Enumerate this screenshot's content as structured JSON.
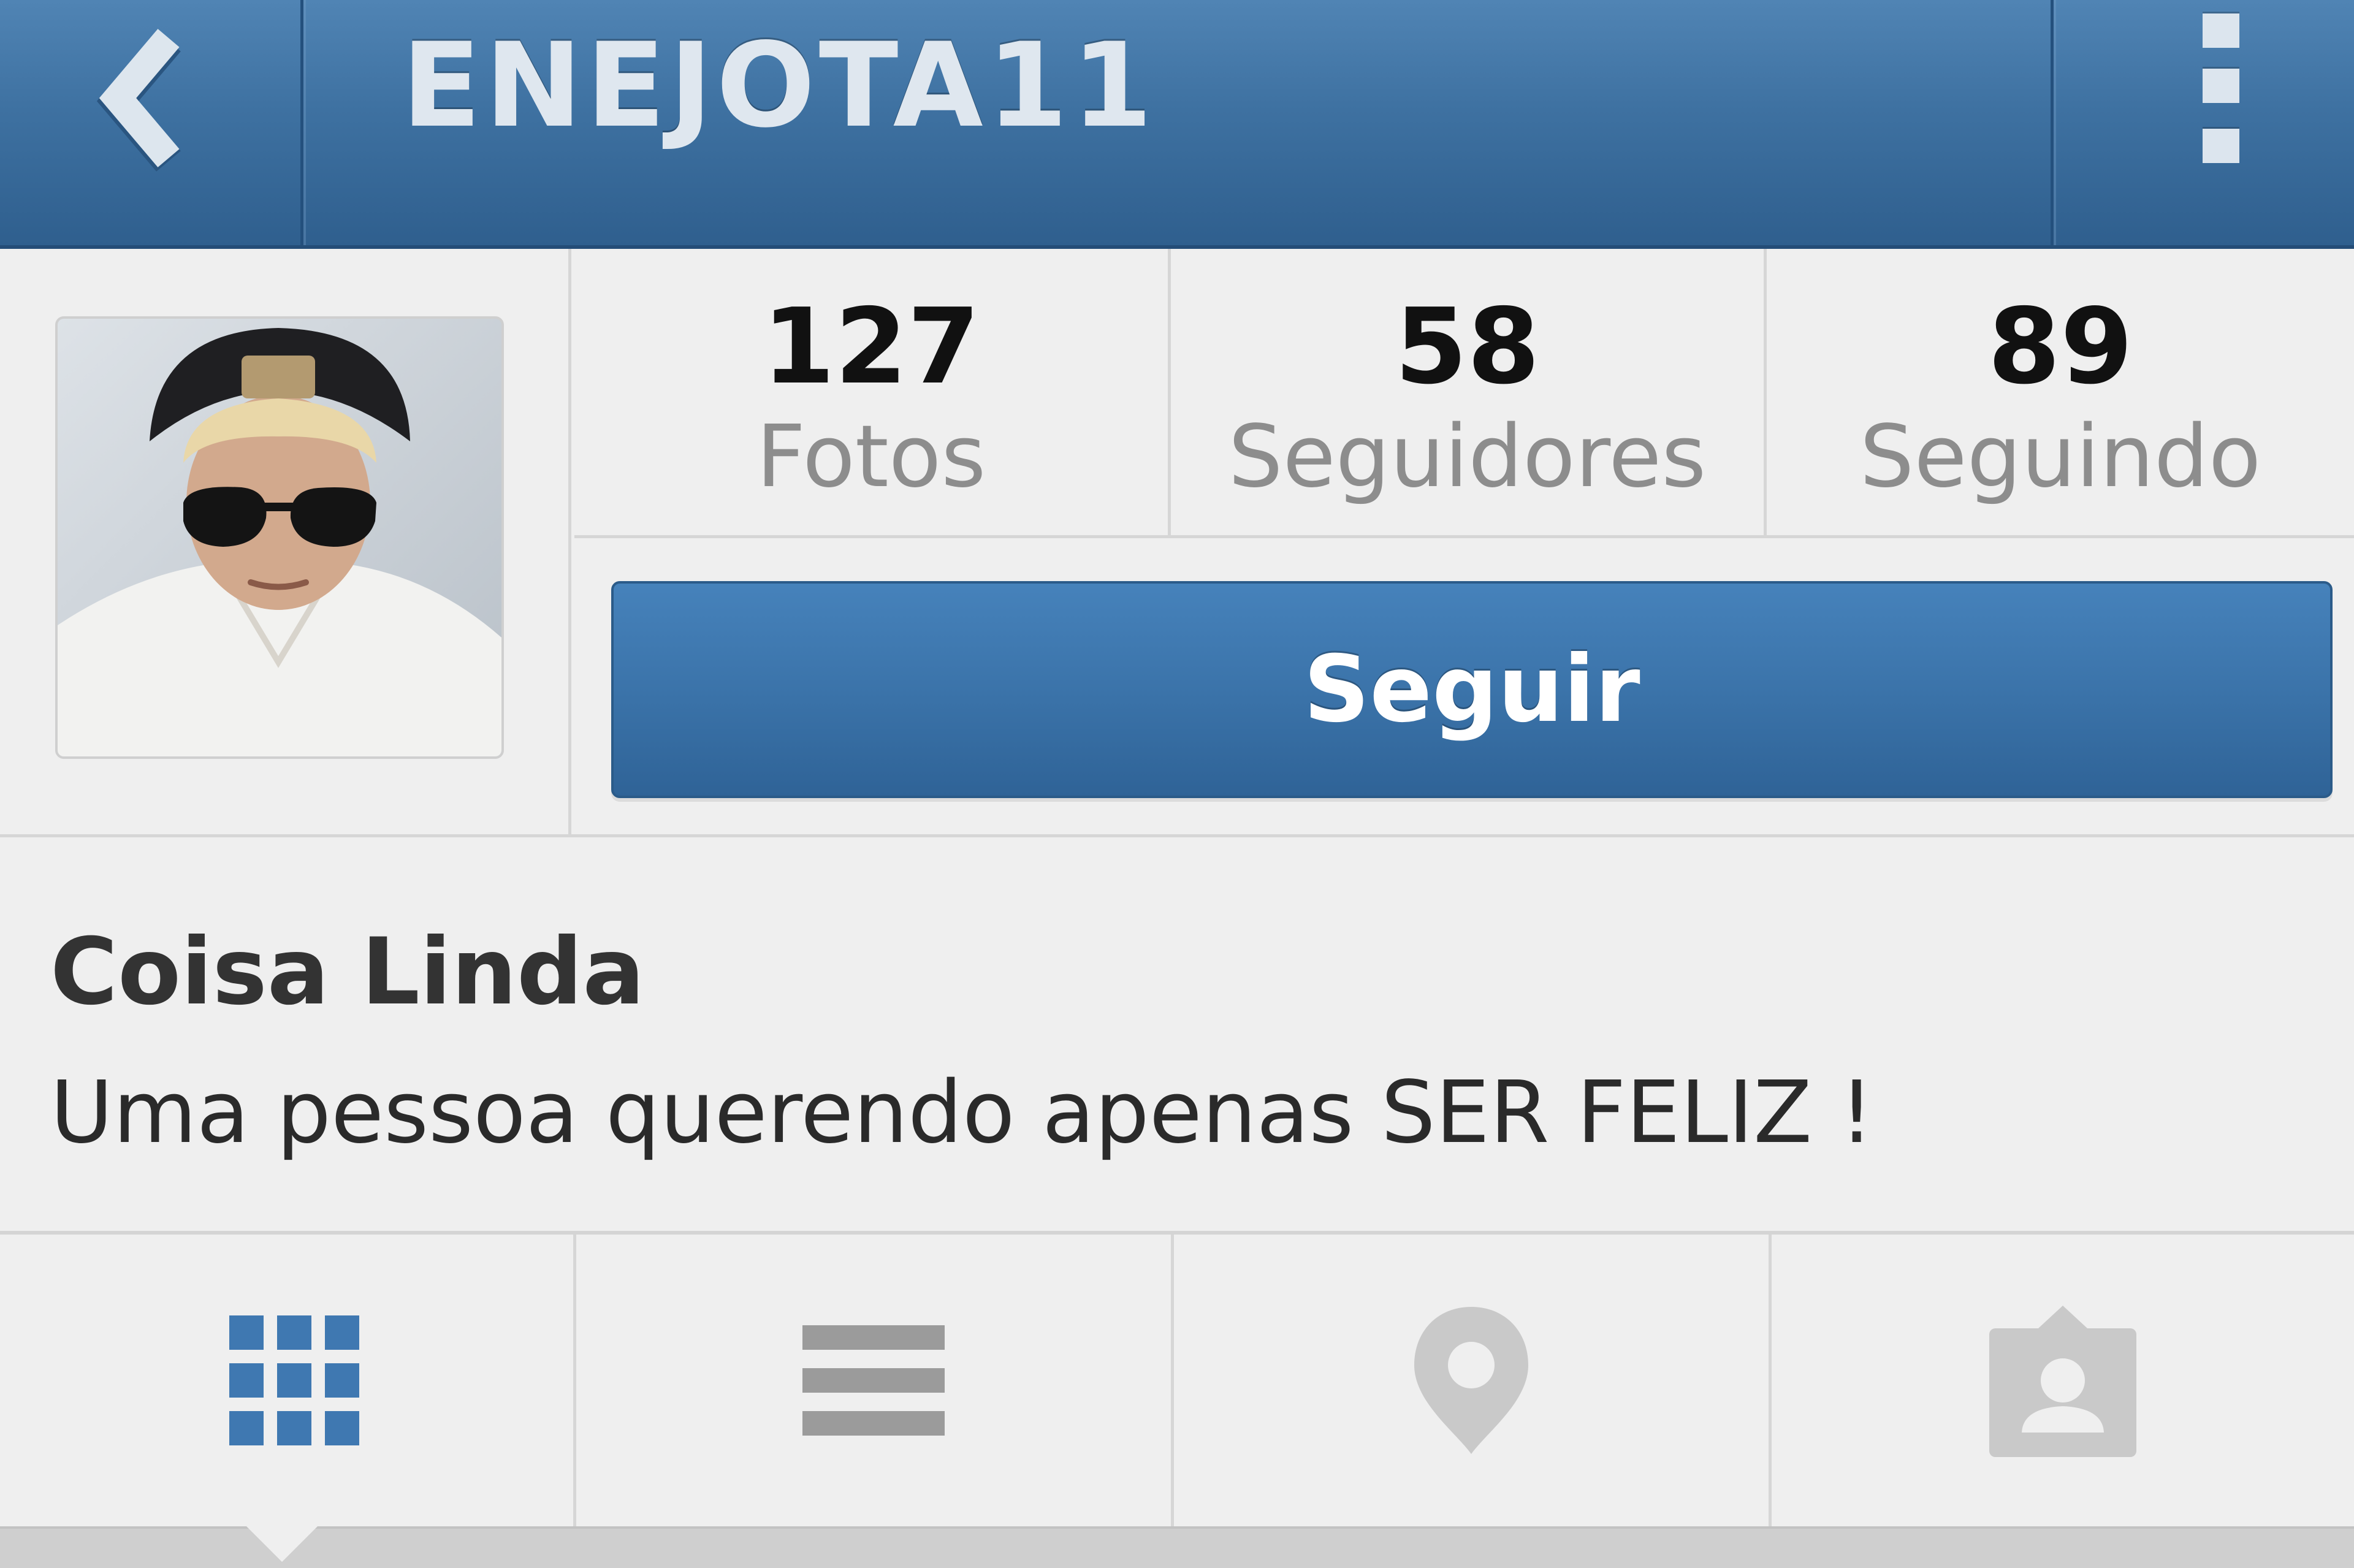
{
  "header": {
    "username": "ENEJOTA11",
    "back_icon": "back-chevron-icon",
    "menu_icon": "overflow-menu-icon",
    "bar_color": "#3e71a1"
  },
  "profile": {
    "avatar_alt": "avatar",
    "stats": [
      {
        "count": "127",
        "label": "Fotos"
      },
      {
        "count": "58",
        "label": "Seguidores"
      },
      {
        "count": "89",
        "label": "Seguindo"
      }
    ],
    "follow_label": "Seguir",
    "follow_color": "#3a72a8"
  },
  "bio": {
    "name": "Coisa Linda",
    "text": "Uma pessoa querendo apenas SER FELIZ !"
  },
  "tabs": [
    {
      "icon": "grid-view-icon",
      "active": true
    },
    {
      "icon": "list-view-icon",
      "active": false
    },
    {
      "icon": "map-pin-icon",
      "active": false
    },
    {
      "icon": "tagged-photos-icon",
      "active": false
    }
  ]
}
